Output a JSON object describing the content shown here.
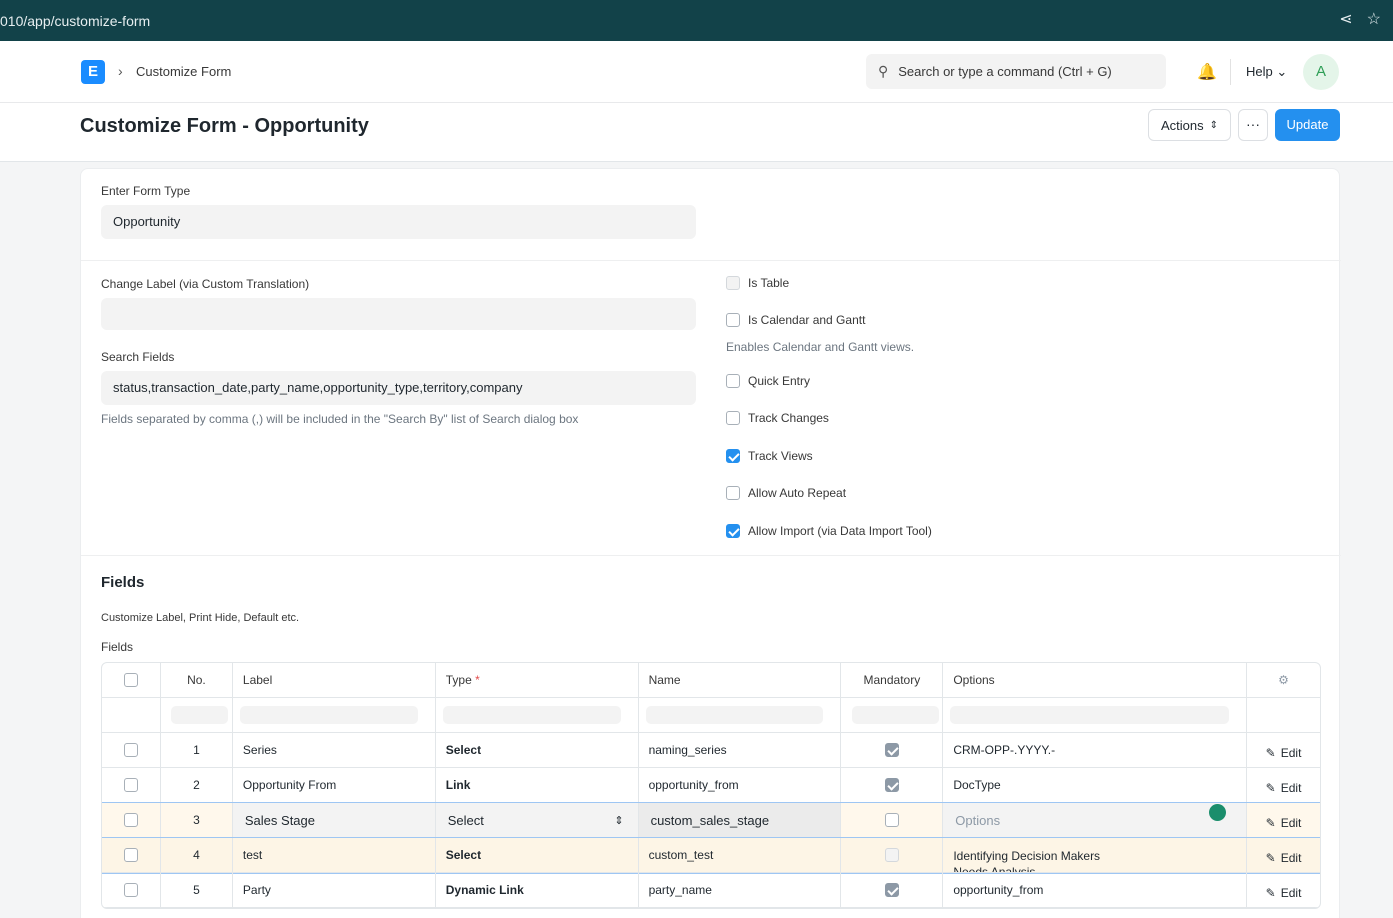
{
  "browser": {
    "url": "010/app/customize-form"
  },
  "navbar": {
    "logo_letter": "E",
    "breadcrumb": "Customize Form",
    "search_placeholder": "Search or type a command (Ctrl + G)",
    "help_label": "Help",
    "avatar_letter": "A"
  },
  "page": {
    "title": "Customize Form - Opportunity",
    "actions_label": "Actions",
    "more_label": "···",
    "update_label": "Update"
  },
  "form": {
    "form_type_label": "Enter Form Type",
    "form_type_value": "Opportunity",
    "change_label_label": "Change Label (via Custom Translation)",
    "change_label_value": "",
    "search_fields_label": "Search Fields",
    "search_fields_value": "status,transaction_date,party_name,opportunity_type,territory,company",
    "search_fields_hint": "Fields separated by comma (,) will be included in the \"Search By\" list of Search dialog box",
    "checkboxes": {
      "is_table": "Is Table",
      "is_calendar": "Is Calendar and Gantt",
      "calendar_hint": "Enables Calendar and Gantt views.",
      "quick_entry": "Quick Entry",
      "track_changes": "Track Changes",
      "track_views": "Track Views",
      "allow_auto_repeat": "Allow Auto Repeat",
      "allow_import": "Allow Import (via Data Import Tool)"
    }
  },
  "fields_section": {
    "title": "Fields",
    "description": "Customize Label, Print Hide, Default etc.",
    "grid_label": "Fields",
    "columns": {
      "no": "No.",
      "label": "Label",
      "type": "Type",
      "required_mark": "*",
      "name": "Name",
      "mandatory": "Mandatory",
      "options": "Options"
    },
    "edit_label": "Edit",
    "rows": [
      {
        "no": "1",
        "label": "Series",
        "type": "Select",
        "name": "naming_series",
        "options": "CRM-OPP-.YYYY.-"
      },
      {
        "no": "2",
        "label": "Opportunity From",
        "type": "Link",
        "name": "opportunity_from",
        "options": "DocType"
      },
      {
        "no": "3",
        "label": "Sales Stage",
        "type": "Select",
        "name": "custom_sales_stage",
        "options": "Options"
      },
      {
        "no": "4",
        "label": "test",
        "type": "Select",
        "name": "custom_test",
        "options": "Identifying Decision Makers",
        "options_overflow": "Needs Analysis"
      },
      {
        "no": "5",
        "label": "Party",
        "type": "Dynamic Link",
        "name": "party_name",
        "options": "opportunity_from"
      }
    ]
  }
}
